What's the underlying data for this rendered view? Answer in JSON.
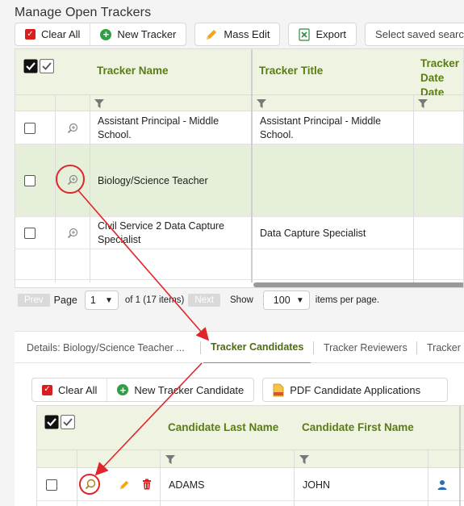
{
  "page": {
    "title": "Manage Open Trackers"
  },
  "toolbar1": {
    "clear_all": "Clear All",
    "new_tracker": "New Tracker",
    "mass_edit": "Mass Edit",
    "export": "Export",
    "saved_search_placeholder": "Select saved search"
  },
  "tracker_grid": {
    "columns": [
      "Tracker Name",
      "Tracker Title",
      "Tracker Date",
      "Date"
    ],
    "rows": [
      {
        "name": "Assistant Principal - Middle School.",
        "title": "Assistant Principal - Middle School.",
        "selected": false
      },
      {
        "name": "Biology/Science Teacher",
        "title": "",
        "selected": true
      },
      {
        "name": "Civil Service 2 Data Capture Specialist",
        "title": "Data Capture Specialist",
        "selected": false
      }
    ]
  },
  "pager": {
    "prev": "Prev",
    "page_label": "Page",
    "page_value": "1",
    "of_text": "of 1 (17 items)",
    "next": "Next",
    "show_label": "Show",
    "per_page_value": "100",
    "per_page_text": "items per page."
  },
  "tabs": [
    {
      "label": "Details: Biology/Science Teacher ...",
      "active": false
    },
    {
      "label": "Tracker Candidates",
      "active": true
    },
    {
      "label": "Tracker Reviewers",
      "active": false
    },
    {
      "label": "Tracker C",
      "active": false
    }
  ],
  "toolbar2": {
    "clear_all": "Clear All",
    "new_candidate": "New Tracker Candidate",
    "pdf_apps": "PDF Candidate Applications"
  },
  "candidate_grid": {
    "columns": [
      "Candidate Last Name",
      "Candidate First Name"
    ],
    "rows": [
      {
        "last": "ADAMS",
        "first": "JOHN"
      }
    ]
  },
  "colors": {
    "header_green": "#5a7d12",
    "annotation_red": "#e0262a",
    "selected_row": "#e6efd9"
  }
}
